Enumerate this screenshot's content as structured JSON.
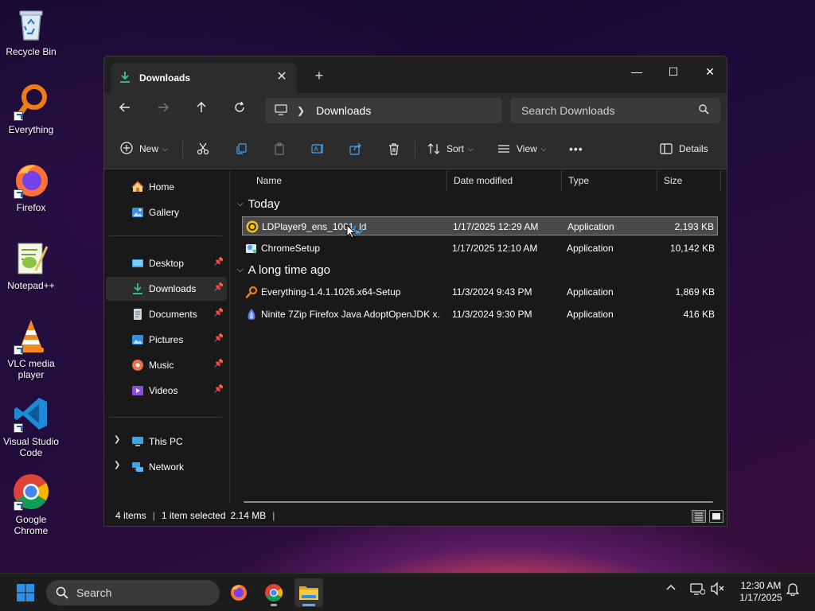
{
  "desktop": {
    "icons": [
      {
        "label": "Recycle Bin",
        "icon": "recycle-bin-icon"
      },
      {
        "label": "Everything",
        "icon": "everything-icon"
      },
      {
        "label": "Firefox",
        "icon": "firefox-icon"
      },
      {
        "label": "Notepad++",
        "icon": "notepad-plus-plus-icon"
      },
      {
        "label": "VLC media player",
        "icon": "vlc-icon"
      },
      {
        "label": "Visual Studio Code",
        "icon": "vscode-icon"
      },
      {
        "label": "Google Chrome",
        "icon": "chrome-icon"
      }
    ]
  },
  "window": {
    "tab_title": "Downloads",
    "controls": {
      "minimize": "—",
      "maximize": "☐",
      "close": "✕"
    }
  },
  "navbar": {
    "breadcrumb": [
      "Downloads"
    ],
    "search_placeholder": "Search Downloads"
  },
  "toolbar": {
    "new_label": "New",
    "sort_label": "Sort",
    "view_label": "View",
    "more_label": "•••",
    "details_label": "Details"
  },
  "sidebar": {
    "items": [
      {
        "label": "Home",
        "icon": "home-icon"
      },
      {
        "label": "Gallery",
        "icon": "gallery-icon"
      },
      {
        "label": "Desktop",
        "icon": "desktop-folder-icon",
        "pinned": true
      },
      {
        "label": "Downloads",
        "icon": "downloads-folder-icon",
        "pinned": true,
        "selected": true
      },
      {
        "label": "Documents",
        "icon": "documents-folder-icon",
        "pinned": true
      },
      {
        "label": "Pictures",
        "icon": "pictures-folder-icon",
        "pinned": true
      },
      {
        "label": "Music",
        "icon": "music-folder-icon",
        "pinned": true
      },
      {
        "label": "Videos",
        "icon": "videos-folder-icon",
        "pinned": true
      },
      {
        "label": "This PC",
        "icon": "this-pc-icon",
        "expandable": true
      },
      {
        "label": "Network",
        "icon": "network-icon",
        "expandable": true
      }
    ]
  },
  "columns": {
    "name": "Name",
    "date": "Date modified",
    "type": "Type",
    "size": "Size"
  },
  "groups": [
    {
      "label": "Today",
      "files": [
        {
          "name": "LDPlayer9_ens_1001_ld",
          "date": "1/17/2025 12:29 AM",
          "type": "Application",
          "size": "2,193 KB",
          "selected": true,
          "icon": "ldplayer-icon"
        },
        {
          "name": "ChromeSetup",
          "date": "1/17/2025 12:10 AM",
          "type": "Application",
          "size": "10,142 KB",
          "icon": "installer-icon"
        }
      ]
    },
    {
      "label": "A long time ago",
      "files": [
        {
          "name": "Everything-1.4.1.1026.x64-Setup",
          "date": "11/3/2024 9:43 PM",
          "type": "Application",
          "size": "1,869 KB",
          "icon": "everything-icon"
        },
        {
          "name": "Ninite 7Zip Firefox Java AdoptOpenJDK x...",
          "date": "11/3/2024 9:30 PM",
          "type": "Application",
          "size": "416 KB",
          "icon": "ninite-icon"
        }
      ]
    }
  ],
  "status": {
    "item_count": "4 items",
    "selection": "1 item selected",
    "selection_size": "2.14 MB"
  },
  "taskbar": {
    "search_label": "Search",
    "apps": [
      "firefox-icon",
      "chrome-icon",
      "file-explorer-icon"
    ],
    "clock_time": "12:30 AM",
    "clock_date": "1/17/2025"
  }
}
